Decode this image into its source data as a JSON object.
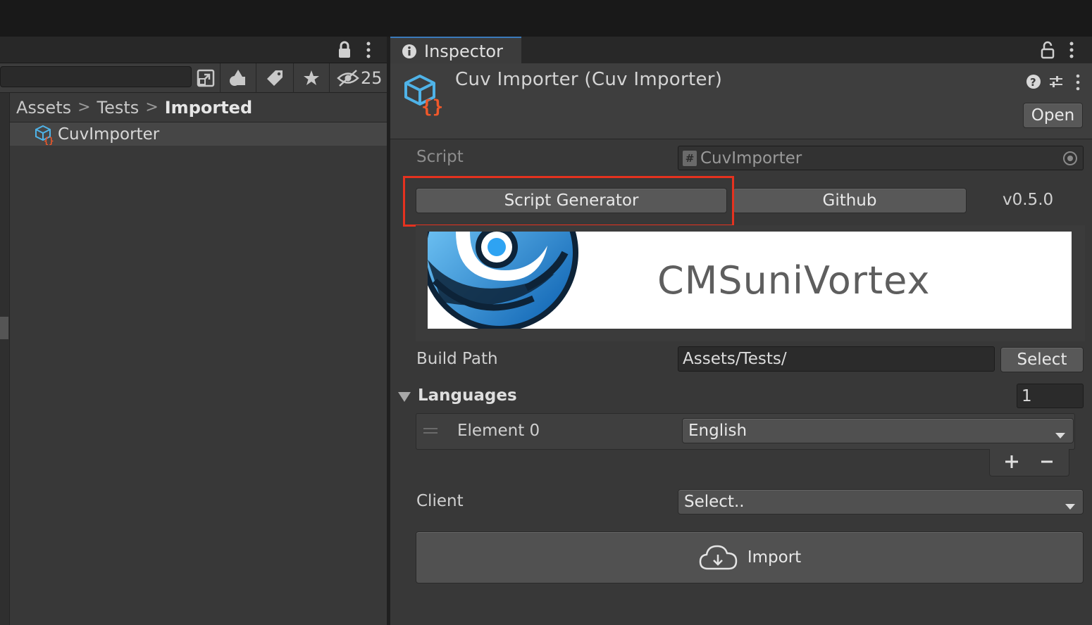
{
  "project": {
    "view_count": "25",
    "breadcrumb": [
      "Assets",
      "Tests",
      "Imported"
    ],
    "items": [
      {
        "name": "CuvImporter"
      }
    ]
  },
  "inspector": {
    "tab_label": "Inspector",
    "title": "Cuv Importer (Cuv Importer)",
    "open_label": "Open",
    "script_label": "Script",
    "script_value": "CuvImporter",
    "script_generator_label": "Script Generator",
    "github_label": "Github",
    "version": "v0.5.0",
    "logo_text": "CMSuniVortex",
    "build_path_label": "Build Path",
    "build_path_value": "Assets/Tests/",
    "select_label": "Select",
    "languages_label": "Languages",
    "languages_count": "1",
    "element0_label": "Element 0",
    "element0_value": "English",
    "client_label": "Client",
    "client_value": "Select..",
    "import_label": "Import"
  },
  "colors": {
    "accent_tab": "#3a79bb",
    "highlight_box": "#e5321f",
    "asset_icon_cube": "#4fb3e8",
    "asset_icon_braces": "#f0582a"
  }
}
